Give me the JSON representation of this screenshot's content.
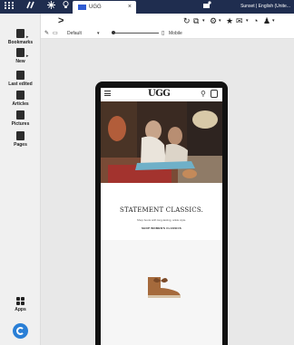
{
  "topbar": {
    "tab_label": "UGG",
    "tab_close": "×",
    "user_label": "Sunset | English (Unite..."
  },
  "toolbar": {
    "device_label": "Default",
    "device_caret": "▾",
    "viewport_label": "Mobile"
  },
  "sidebar": {
    "items": [
      {
        "label": "Bookmarks"
      },
      {
        "label": "New"
      },
      {
        "label": "Last edited"
      },
      {
        "label": "Articles"
      },
      {
        "label": "Pictures"
      },
      {
        "label": "Pages"
      }
    ],
    "apps_label": "Apps"
  },
  "site": {
    "logo": "UGG",
    "headline": "STATEMENT CLASSICS.",
    "subline": "Shop boots with long-lasting, ankle style.",
    "cta": "SHOP WOMEN'S CLASSICS"
  },
  "colors": {
    "topbar_bg": "#1f2d4f",
    "brand_blue": "#2a7fd6",
    "canvas_bg": "#e8e8e8"
  }
}
